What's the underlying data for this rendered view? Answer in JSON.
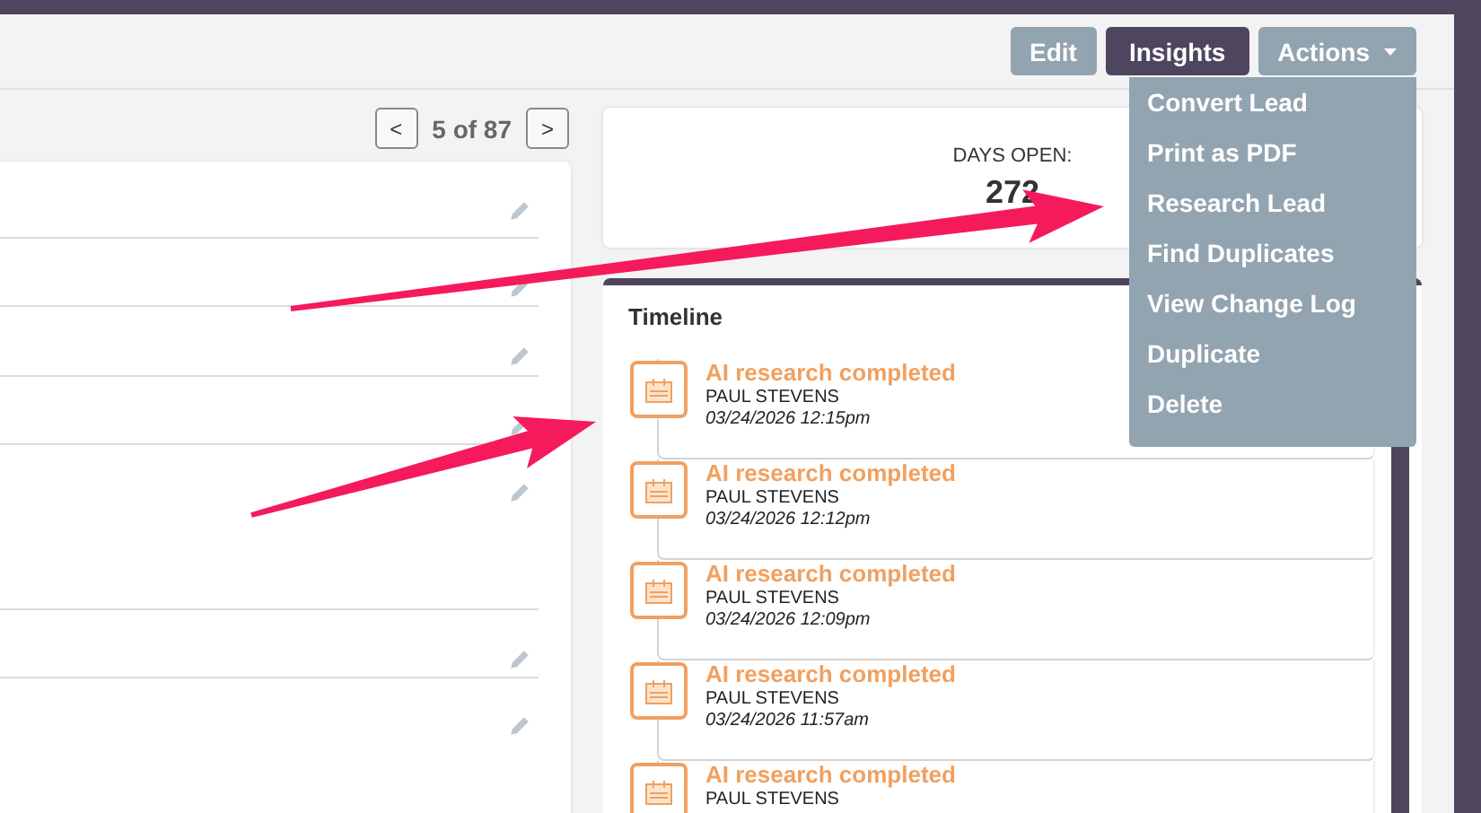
{
  "header": {
    "buttons": [
      {
        "label": "Edit",
        "kind": "secondary"
      },
      {
        "label": "Insights",
        "kind": "primary"
      },
      {
        "label": "Actions",
        "kind": "dropdown",
        "expanded": true
      }
    ]
  },
  "actions_menu": [
    "Convert Lead",
    "Print as PDF",
    "Research Lead",
    "Find Duplicates",
    "View Change Log",
    "Duplicate",
    "Delete"
  ],
  "pager": {
    "prev": "<",
    "position": "5 of 87",
    "next": ">"
  },
  "days_open": {
    "label": "DAYS OPEN:",
    "value": "272"
  },
  "timeline": {
    "title": "Timeline",
    "items": [
      {
        "title": "AI research completed",
        "user": "PAUL STEVENS",
        "date": "03/24/2026 12:15pm"
      },
      {
        "title": "AI research completed",
        "user": "PAUL STEVENS",
        "date": "03/24/2026 12:12pm"
      },
      {
        "title": "AI research completed",
        "user": "PAUL STEVENS",
        "date": "03/24/2026 12:09pm"
      },
      {
        "title": "AI research completed",
        "user": "PAUL STEVENS",
        "date": "03/24/2026 11:57am"
      },
      {
        "title": "AI research completed",
        "user": "PAUL STEVENS"
      }
    ]
  }
}
